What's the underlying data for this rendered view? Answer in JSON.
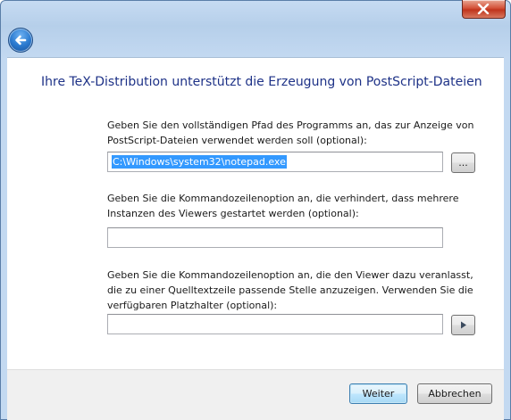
{
  "window": {
    "close_icon": "close-x-icon",
    "back_icon": "back-arrow-icon"
  },
  "heading": "Ihre TeX-Distribution unterstützt die Erzeugung von PostScript-Dateien",
  "section1": {
    "label": "Geben Sie den vollständigen Pfad des Programms an, das zur Anzeige von PostScript-Dateien verwendet werden soll (optional):",
    "value": "C:\\Windows\\system32\\notepad.exe",
    "browse_label": "..."
  },
  "section2": {
    "label": "Geben Sie die Kommandozeilenoption an, die verhindert, dass mehrere Instanzen des Viewers gestartet werden (optional):",
    "value": ""
  },
  "section3": {
    "label": "Geben Sie die Kommandozeilenoption an, die den Viewer dazu veranlasst, die zu einer Quelltextzeile passende Stelle anzuzeigen. Verwenden Sie die verfügbaren Platzhalter (optional):",
    "value": "",
    "arrow_icon": "play-arrow-icon"
  },
  "buttons": {
    "next": "Weiter",
    "cancel": "Abbrechen"
  }
}
